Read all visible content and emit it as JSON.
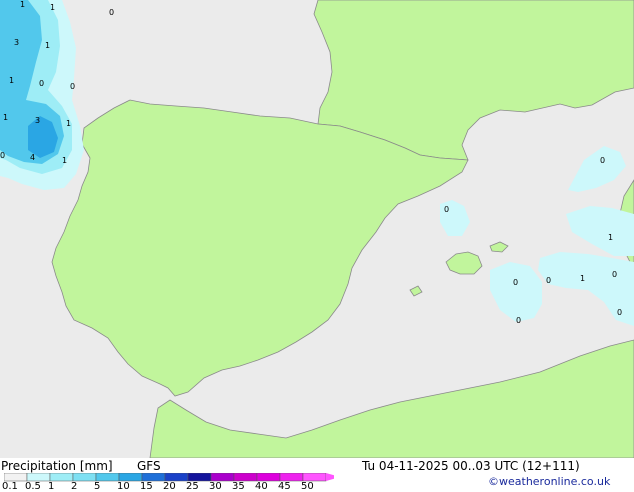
{
  "legend": {
    "title": "Precipitation [mm]",
    "model": "GFS",
    "ticks": [
      "0.1",
      "0.5",
      "1",
      "2",
      "5",
      "10",
      "15",
      "20",
      "25",
      "30",
      "35",
      "40",
      "45",
      "50"
    ],
    "colors": [
      "#f2f2f2",
      "#cdf8fb",
      "#9eedf6",
      "#7ee0f3",
      "#52c8ec",
      "#2aa6e4",
      "#1e6fd8",
      "#1a41c8",
      "#14149c",
      "#aa00cc",
      "#cc00cc",
      "#dd00dd",
      "#ee22ee",
      "#ff55ff"
    ]
  },
  "timestamp": "Tu 04-11-2025 00..03 UTC (12+111)",
  "credit": "©weatheronline.co.uk",
  "map_labels": [
    {
      "id": "a1",
      "text": "1"
    },
    {
      "id": "a2",
      "text": "1"
    },
    {
      "id": "a3",
      "text": "0"
    },
    {
      "id": "a4",
      "text": "3"
    },
    {
      "id": "a5",
      "text": "1"
    },
    {
      "id": "a6",
      "text": "1"
    },
    {
      "id": "a7",
      "text": "0"
    },
    {
      "id": "a8",
      "text": "0"
    },
    {
      "id": "a9",
      "text": "1"
    },
    {
      "id": "a10",
      "text": "3"
    },
    {
      "id": "a11",
      "text": "1"
    },
    {
      "id": "a12",
      "text": "0"
    },
    {
      "id": "a13",
      "text": "4"
    },
    {
      "id": "a14",
      "text": "1"
    },
    {
      "id": "a15",
      "text": "0"
    },
    {
      "id": "a16",
      "text": "0"
    },
    {
      "id": "a17",
      "text": "1"
    },
    {
      "id": "a18",
      "text": "0"
    },
    {
      "id": "a19",
      "text": "1"
    },
    {
      "id": "a20",
      "text": "0"
    },
    {
      "id": "a21",
      "text": "0"
    },
    {
      "id": "a22",
      "text": "0"
    },
    {
      "id": "a23",
      "text": "0"
    }
  ],
  "colors": {
    "sea": "#ebebeb",
    "land": "#c1f59c",
    "coast": "#8a8a8a",
    "precip_light": "#cdf8fb",
    "precip_mid": "#9eedf6",
    "precip_strong": "#52c8ec",
    "precip_heavy": "#2aa6e4"
  }
}
